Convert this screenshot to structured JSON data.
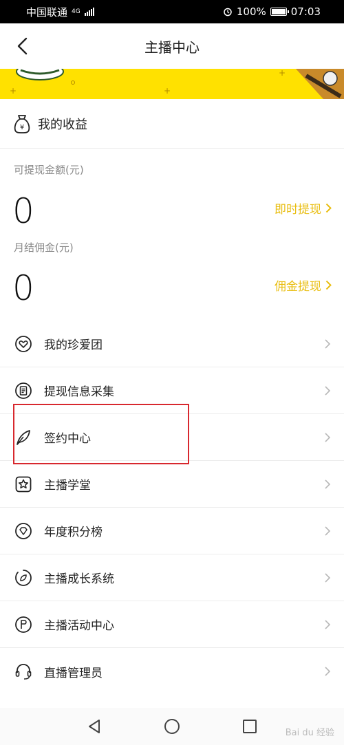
{
  "status_bar": {
    "carrier": "中国联通",
    "network": "4G",
    "alarm": "alarm-icon",
    "battery_pct": "100%",
    "time": "07:03"
  },
  "nav": {
    "title": "主播中心",
    "back_icon": "chevron-left-icon"
  },
  "earnings": {
    "header": "我的收益",
    "withdrawable_label": "可提现金额(元)",
    "withdrawable_value": "0",
    "withdraw_action": "即时提现",
    "commission_label": "月结佣金(元)",
    "commission_value": "0",
    "commission_action": "佣金提现"
  },
  "menu": [
    {
      "label": "我的珍爱团",
      "icon": "heart-circle-icon"
    },
    {
      "label": "提现信息采集",
      "icon": "document-circle-icon"
    },
    {
      "label": "签约中心",
      "icon": "feather-icon"
    },
    {
      "label": "主播学堂",
      "icon": "star-square-icon"
    },
    {
      "label": "年度积分榜",
      "icon": "diamond-circle-icon"
    },
    {
      "label": "主播成长系统",
      "icon": "leaf-circle-icon"
    },
    {
      "label": "主播活动中心",
      "icon": "flag-circle-icon"
    },
    {
      "label": "直播管理员",
      "icon": "headset-icon"
    }
  ],
  "colors": {
    "accent": "#e9be12",
    "banner": "#ffe100",
    "highlight_box": "#d8282e"
  },
  "watermark": "Bai du 经验"
}
